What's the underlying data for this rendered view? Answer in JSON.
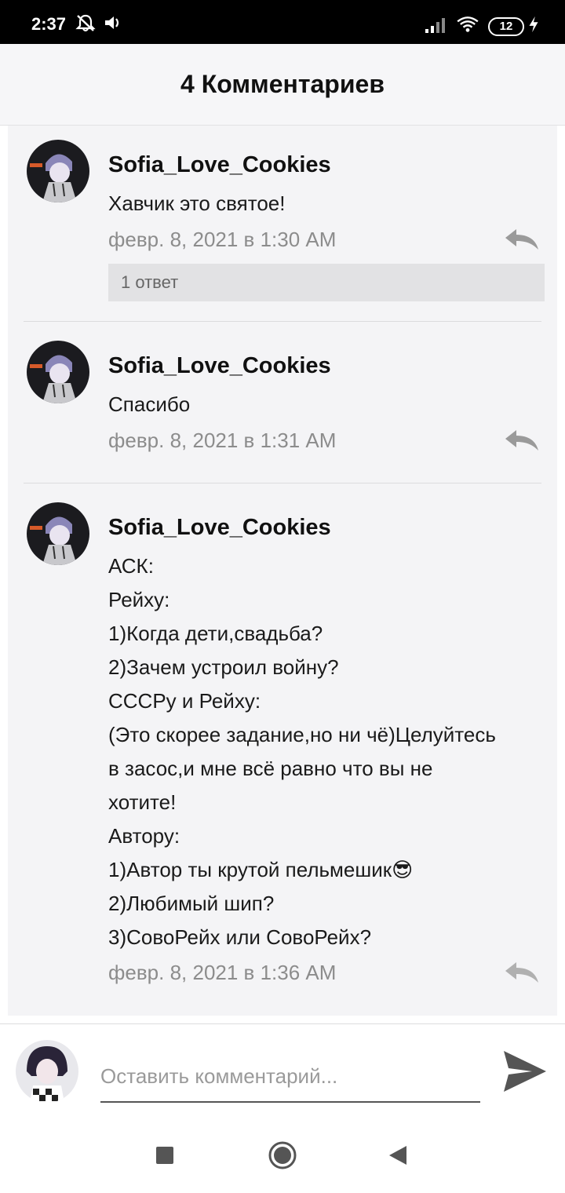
{
  "status_bar": {
    "time": "2:37",
    "battery_level": "12",
    "icons": [
      "notifications-off-icon",
      "volume-icon",
      "signal-icon",
      "wifi-icon",
      "battery-icon",
      "charging-icon"
    ]
  },
  "header": {
    "title": "4 Комментариев"
  },
  "comments": [
    {
      "username": "Sofia_Love_Cookies",
      "text": "Хавчик это святое!",
      "time": "февр. 8, 2021 в 1:30 AM",
      "replies_label": "1 ответ"
    },
    {
      "username": "Sofia_Love_Cookies",
      "text": "Спасибо",
      "time": "февр. 8, 2021 в 1:31 AM"
    },
    {
      "username": "Sofia_Love_Cookies",
      "text_lines": [
        "АСК:",
        "Рейху:",
        "1)Когда дети,свадьба?",
        "2)Зачем устроил войну?",
        "СССРу и Рейху:",
        "(Это скорее задание,но ни чё)Целуйтесь",
        "в засос,и мне всё равно что вы не",
        "хотите!",
        "Автору:",
        "1)Автор ты крутой пельмешик😎",
        "2)Любимый шип?",
        "3)СовоРейх или СовоРейх?"
      ],
      "time": "февр. 8, 2021 в 1:36 AM"
    }
  ],
  "input": {
    "placeholder": "Оставить комментарий...",
    "value": ""
  },
  "colors": {
    "header_bg": "#f6f6f8",
    "card_bg": "#f4f4f6",
    "muted": "#8c8c8c",
    "replies_bg": "#e2e2e4"
  }
}
